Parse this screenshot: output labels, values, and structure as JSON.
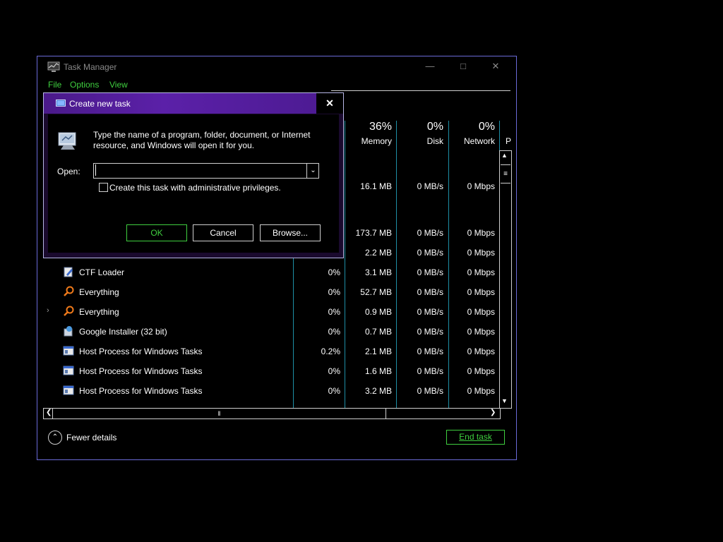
{
  "task_manager": {
    "title": "Task Manager",
    "menu": [
      "File",
      "Options",
      "View"
    ],
    "columns": {
      "memory": {
        "pct": "36%",
        "label": "Memory"
      },
      "disk": {
        "pct": "0%",
        "label": "Disk"
      },
      "network": {
        "pct": "0%",
        "label": "Network"
      },
      "power": {
        "label": "P"
      }
    },
    "rows": [
      {
        "name": "",
        "cpu": "",
        "memory": "16.1 MB",
        "disk": "0 MB/s",
        "network": "0 Mbps"
      },
      {
        "name": "",
        "cpu": "",
        "memory": "173.7 MB",
        "disk": "0 MB/s",
        "network": "0 Mbps"
      },
      {
        "name": "",
        "cpu": "",
        "memory": "2.2 MB",
        "disk": "0 MB/s",
        "network": "0 Mbps"
      },
      {
        "name": "CTF Loader",
        "cpu": "0%",
        "memory": "3.1 MB",
        "disk": "0 MB/s",
        "network": "0 Mbps",
        "icon": "pen-icon"
      },
      {
        "name": "Everything",
        "cpu": "0%",
        "memory": "52.7 MB",
        "disk": "0 MB/s",
        "network": "0 Mbps",
        "icon": "magnifier-icon"
      },
      {
        "name": "Everything",
        "cpu": "0%",
        "memory": "0.9 MB",
        "disk": "0 MB/s",
        "network": "0 Mbps",
        "icon": "magnifier-icon",
        "expandable": true
      },
      {
        "name": "Google Installer (32 bit)",
        "cpu": "0%",
        "memory": "0.7 MB",
        "disk": "0 MB/s",
        "network": "0 Mbps",
        "icon": "installer-icon"
      },
      {
        "name": "Host Process for Windows Tasks",
        "cpu": "0.2%",
        "memory": "2.1 MB",
        "disk": "0 MB/s",
        "network": "0 Mbps",
        "icon": "window-icon"
      },
      {
        "name": "Host Process for Windows Tasks",
        "cpu": "0%",
        "memory": "1.6 MB",
        "disk": "0 MB/s",
        "network": "0 Mbps",
        "icon": "window-icon"
      },
      {
        "name": "Host Process for Windows Tasks",
        "cpu": "0%",
        "memory": "3.2 MB",
        "disk": "0 MB/s",
        "network": "0 Mbps",
        "icon": "window-icon"
      }
    ],
    "fewer_details": "Fewer details",
    "end_task": "End task"
  },
  "dialog": {
    "title": "Create new task",
    "description_line1": "Type the name of a program, folder, document, or Internet",
    "description_line2": "resource, and Windows will open it for you.",
    "open_label": "Open:",
    "open_value": "",
    "admin_checkbox_label": "Create this task with administrative privileges.",
    "admin_checked": false,
    "ok": "OK",
    "cancel": "Cancel",
    "browse": "Browse..."
  },
  "colors": {
    "accent_green": "#3fcf3f",
    "dialog_title": "#5b20a8",
    "column_divider": "#1e8fa6",
    "window_border": "#6a6ad8"
  }
}
